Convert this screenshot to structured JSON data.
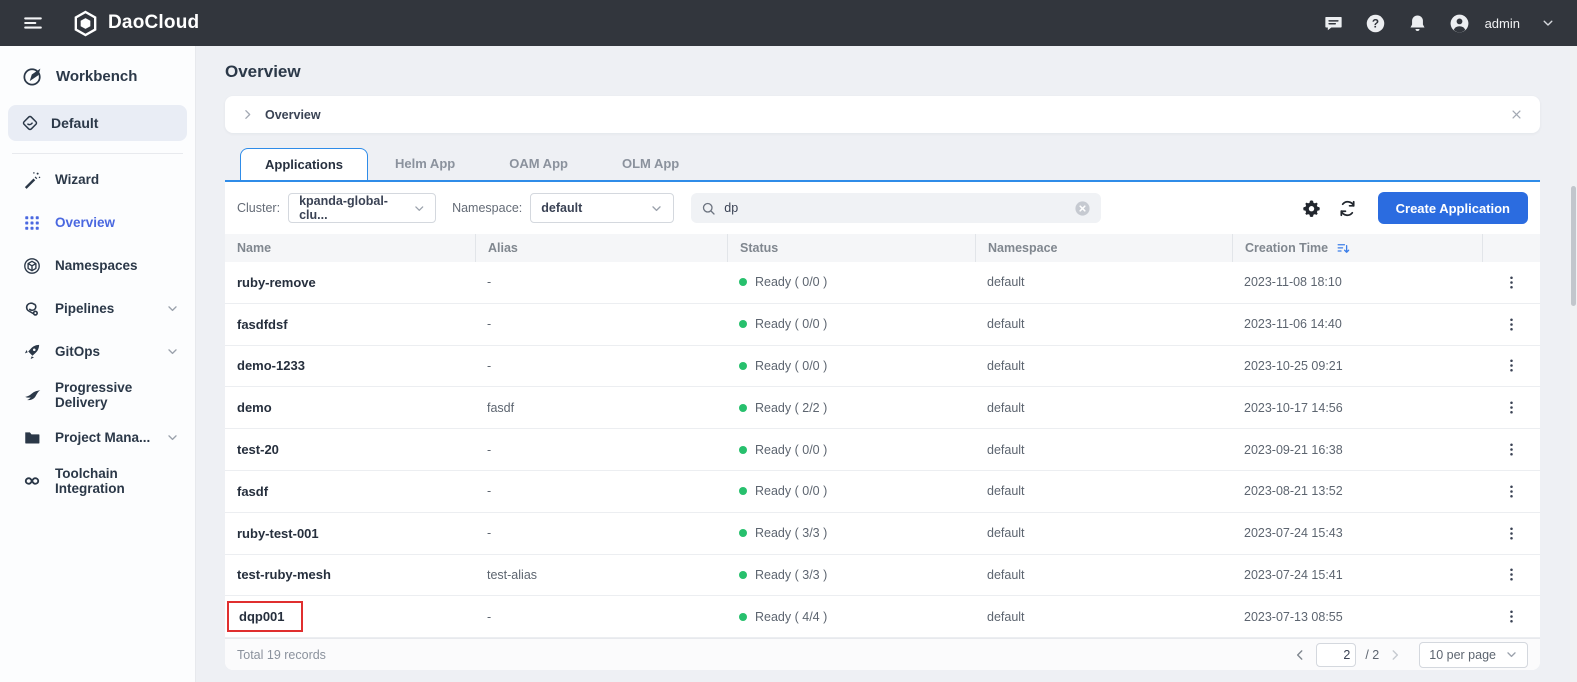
{
  "header": {
    "brand": "DaoCloud",
    "user": "admin",
    "icons": [
      "message-icon",
      "help-icon",
      "bell-icon",
      "avatar-icon"
    ]
  },
  "sidebar": {
    "workbench": {
      "label": "Workbench",
      "icon": "compass-icon"
    },
    "workspace": {
      "label": "Default",
      "icon": "workspace-icon",
      "swap_icon": "swap-icon"
    },
    "items": [
      {
        "label": "Wizard",
        "icon": "wand-icon",
        "active": false,
        "expandable": false
      },
      {
        "label": "Overview",
        "icon": "grid-icon",
        "active": true,
        "expandable": false
      },
      {
        "label": "Namespaces",
        "icon": "cube-icon",
        "active": false,
        "expandable": false
      },
      {
        "label": "Pipelines",
        "icon": "pipeline-icon",
        "active": false,
        "expandable": true
      },
      {
        "label": "GitOps",
        "icon": "rocket-icon",
        "active": false,
        "expandable": true
      },
      {
        "label": "Progressive Delivery",
        "icon": "bird-icon",
        "active": false,
        "expandable": false
      },
      {
        "label": "Project Mana...",
        "icon": "folder-icon",
        "active": false,
        "expandable": true
      },
      {
        "label": "Toolchain Integration",
        "icon": "infinity-icon",
        "active": false,
        "expandable": false
      }
    ]
  },
  "page": {
    "title": "Overview",
    "breadcrumb": "Overview"
  },
  "tabs": [
    {
      "label": "Applications",
      "active": true
    },
    {
      "label": "Helm App",
      "active": false
    },
    {
      "label": "OAM App",
      "active": false
    },
    {
      "label": "OLM App",
      "active": false
    }
  ],
  "filters": {
    "cluster_label": "Cluster:",
    "cluster_value": "kpanda-global-clu...",
    "namespace_label": "Namespace:",
    "namespace_value": "default",
    "search_value": "dp",
    "create_button": "Create Application"
  },
  "table": {
    "columns": [
      "Name",
      "Alias",
      "Status",
      "Namespace",
      "Creation Time"
    ],
    "sorted_column": "Creation Time",
    "rows": [
      {
        "name": "ruby-remove",
        "alias": "-",
        "status": "Ready ( 0/0 )",
        "namespace": "default",
        "created": "2023-11-08 18:10",
        "highlighted": false
      },
      {
        "name": "fasdfdsf",
        "alias": "-",
        "status": "Ready ( 0/0 )",
        "namespace": "default",
        "created": "2023-11-06 14:40",
        "highlighted": false
      },
      {
        "name": "demo-1233",
        "alias": "-",
        "status": "Ready ( 0/0 )",
        "namespace": "default",
        "created": "2023-10-25 09:21",
        "highlighted": false
      },
      {
        "name": "demo",
        "alias": "fasdf",
        "status": "Ready ( 2/2 )",
        "namespace": "default",
        "created": "2023-10-17 14:56",
        "highlighted": false
      },
      {
        "name": "test-20",
        "alias": "-",
        "status": "Ready ( 0/0 )",
        "namespace": "default",
        "created": "2023-09-21 16:38",
        "highlighted": false
      },
      {
        "name": "fasdf",
        "alias": "-",
        "status": "Ready ( 0/0 )",
        "namespace": "default",
        "created": "2023-08-21 13:52",
        "highlighted": false
      },
      {
        "name": "ruby-test-001",
        "alias": "-",
        "status": "Ready ( 3/3 )",
        "namespace": "default",
        "created": "2023-07-24 15:43",
        "highlighted": false
      },
      {
        "name": "test-ruby-mesh",
        "alias": "test-alias",
        "status": "Ready ( 3/3 )",
        "namespace": "default",
        "created": "2023-07-24 15:41",
        "highlighted": false
      },
      {
        "name": "dqp001",
        "alias": "-",
        "status": "Ready ( 4/4 )",
        "namespace": "default",
        "created": "2023-07-13 08:55",
        "highlighted": true
      }
    ]
  },
  "pagination": {
    "total": "Total 19 records",
    "current_page": "2",
    "total_pages": "/ 2",
    "page_size": "10 per page"
  },
  "colors": {
    "accent_blue": "#2b6ce0",
    "tab_blue": "#2f8ce8",
    "link_blue": "#4a68e0",
    "status_green": "#27c06d",
    "highlight_red": "#e02f2f",
    "topbar_dark": "#32363d"
  }
}
